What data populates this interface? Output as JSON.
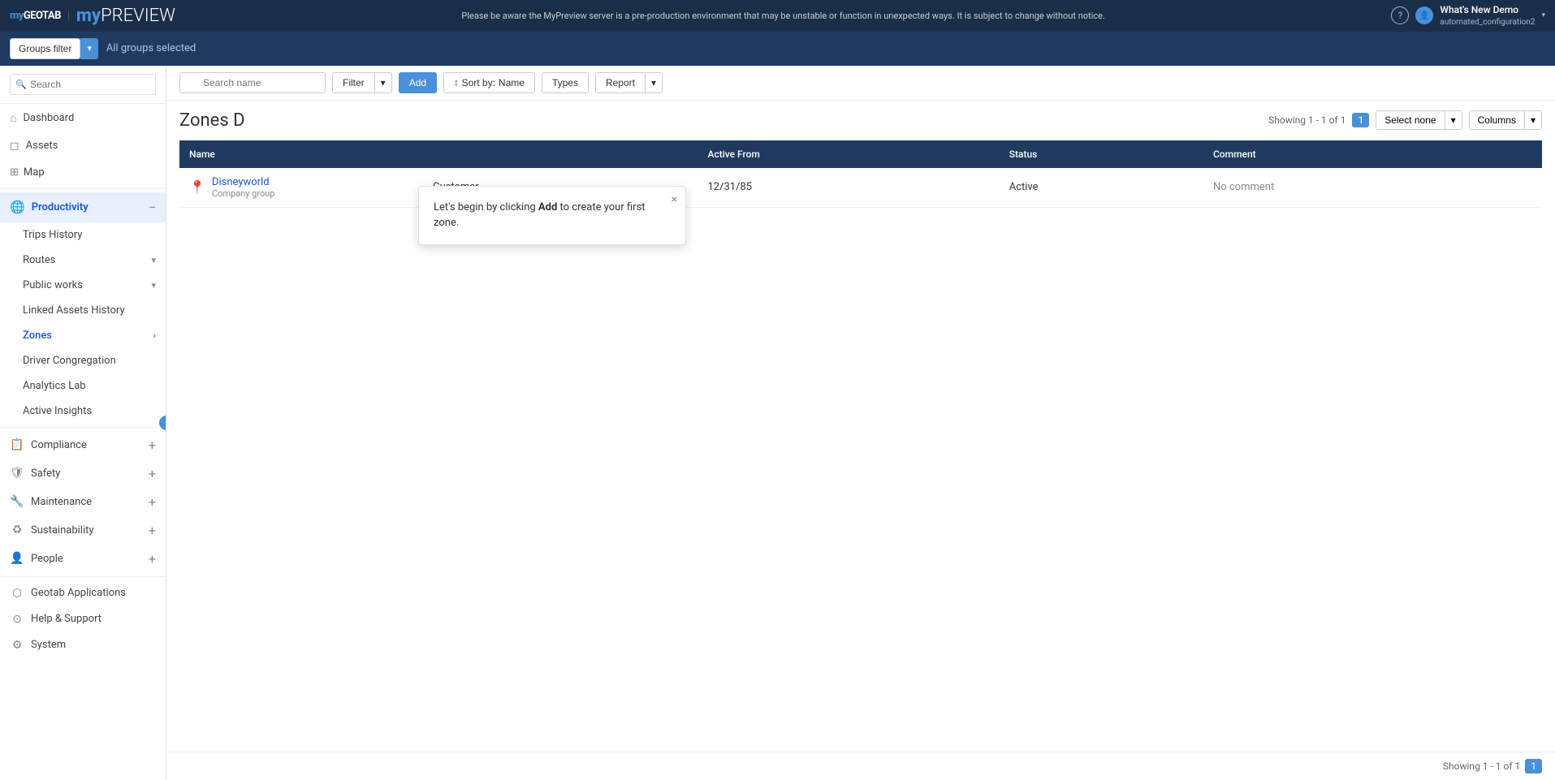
{
  "banner": {
    "logo_my": "my",
    "logo_geotab": "GEOTAB",
    "preview_logo": "myPREVIEW",
    "message": "Please be aware the MyPreview server is a pre-production environment that may be unstable or function in unexpected ways. It is subject to change without notice.",
    "help_icon": "?",
    "user_name": "What's New Demo",
    "user_sub": "automated_configuration2",
    "chevron": "▾"
  },
  "header_bar": {
    "groups_filter_label": "Groups filter",
    "groups_filter_arrow": "▾",
    "all_groups_text": "All groups selected"
  },
  "sidebar": {
    "collapse_icon": "‹",
    "search_placeholder": "Search",
    "nav": [
      {
        "id": "dashboard",
        "label": "Dashboard",
        "icon": "⌂"
      },
      {
        "id": "assets",
        "label": "Assets",
        "icon": "◻"
      }
    ],
    "map_label": "Map",
    "map_icon": "⊞",
    "productivity_label": "Productivity",
    "productivity_icon": "🌐",
    "productivity_collapse": "−",
    "sub_items": [
      {
        "id": "trips-history",
        "label": "Trips History",
        "arrow": ""
      },
      {
        "id": "routes",
        "label": "Routes",
        "arrow": "▾"
      },
      {
        "id": "public-works",
        "label": "Public works",
        "arrow": "▾"
      },
      {
        "id": "linked-assets-history",
        "label": "Linked Assets History",
        "arrow": ""
      },
      {
        "id": "zones",
        "label": "Zones",
        "arrow": "›",
        "active": true
      },
      {
        "id": "driver-congregation",
        "label": "Driver Congregation",
        "arrow": ""
      },
      {
        "id": "analytics-lab",
        "label": "Analytics Lab",
        "arrow": ""
      },
      {
        "id": "active-insights",
        "label": "Active Insights",
        "arrow": ""
      }
    ],
    "categories": [
      {
        "id": "compliance",
        "label": "Compliance",
        "icon": "📋"
      },
      {
        "id": "safety",
        "label": "Safety",
        "icon": "🛡"
      },
      {
        "id": "maintenance",
        "label": "Maintenance",
        "icon": "🔧"
      },
      {
        "id": "sustainability",
        "label": "Sustainability",
        "icon": "♻"
      },
      {
        "id": "people",
        "label": "People",
        "icon": "👤"
      }
    ],
    "bottom_items": [
      {
        "id": "geotab-applications",
        "label": "Geotab Applications",
        "icon": "⬡"
      },
      {
        "id": "help-support",
        "label": "Help & Support",
        "icon": "⊙"
      },
      {
        "id": "system",
        "label": "System",
        "icon": "⚙"
      }
    ]
  },
  "toolbar": {
    "search_placeholder": "Search name",
    "filter_label": "Filter",
    "filter_arrow": "▾",
    "add_label": "Add",
    "sort_label": "Sort by:",
    "sort_value": "Name",
    "types_label": "Types",
    "report_label": "Report",
    "report_arrow": "▾"
  },
  "page": {
    "title": "Zones D",
    "showing_prefix": "Showing 1 - 1 of 1",
    "page_num": "1",
    "select_none_label": "Select none",
    "select_none_arrow": "▾",
    "columns_label": "Columns",
    "columns_arrow": "▾"
  },
  "table": {
    "columns": [
      {
        "id": "name",
        "label": "Name"
      },
      {
        "id": "group",
        "label": ""
      },
      {
        "id": "active-from",
        "label": "Active From"
      },
      {
        "id": "status",
        "label": "Status"
      },
      {
        "id": "comment",
        "label": "Comment"
      }
    ],
    "rows": [
      {
        "name": "Disneyworld",
        "subtext": "Company group",
        "group": "Customer",
        "active_from": "12/31/85",
        "status": "Active",
        "comment": "No comment"
      }
    ]
  },
  "tooltip": {
    "text_before": "Let's begin by clicking ",
    "text_bold": "Add",
    "text_after": " to create your first zone.",
    "close_icon": "×"
  },
  "bottom": {
    "showing": "Showing 1 - 1 of 1",
    "page_num": "1"
  }
}
